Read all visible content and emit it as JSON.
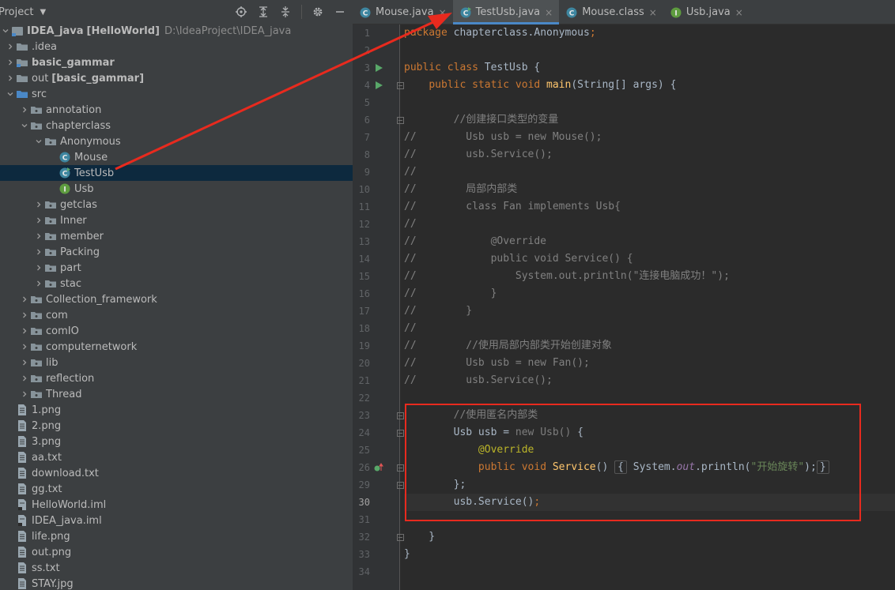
{
  "panel": {
    "title": "Project",
    "tools": [
      "locate-icon",
      "expand-all-icon",
      "collapse-all-icon",
      "gear-icon",
      "minimize-icon"
    ]
  },
  "tree": [
    {
      "label": "IDEA_java",
      "suffix": "[HelloWorld]",
      "path": "D:\\IdeaProject\\IDEA_java",
      "icon": "module-icon",
      "indent": 0,
      "arrow": "open"
    },
    {
      "label": ".idea",
      "icon": "folder-icon",
      "indent": 1,
      "arrow": "closed"
    },
    {
      "label": "basic_gammar",
      "icon": "module-folder-icon",
      "indent": 1,
      "arrow": "closed",
      "bold": true
    },
    {
      "label": "out",
      "suffix": "[basic_gammar]",
      "icon": "folder-icon",
      "indent": 1,
      "arrow": "closed"
    },
    {
      "label": "src",
      "icon": "source-folder-icon",
      "indent": 1,
      "arrow": "open"
    },
    {
      "label": "annotation",
      "icon": "package-icon",
      "indent": 2,
      "arrow": "closed"
    },
    {
      "label": "chapterclass",
      "icon": "package-icon",
      "indent": 2,
      "arrow": "open"
    },
    {
      "label": "Anonymous",
      "icon": "package-icon",
      "indent": 3,
      "arrow": "open"
    },
    {
      "label": "Mouse",
      "icon": "class-icon",
      "indent": 4,
      "arrow": "none"
    },
    {
      "label": "TestUsb",
      "icon": "runnable-class-icon",
      "indent": 4,
      "arrow": "none",
      "selected": true
    },
    {
      "label": "Usb",
      "icon": "interface-icon",
      "indent": 4,
      "arrow": "none"
    },
    {
      "label": "getclas",
      "icon": "package-icon",
      "indent": 3,
      "arrow": "closed"
    },
    {
      "label": "Inner",
      "icon": "package-icon",
      "indent": 3,
      "arrow": "closed"
    },
    {
      "label": "member",
      "icon": "package-icon",
      "indent": 3,
      "arrow": "closed"
    },
    {
      "label": "Packing",
      "icon": "package-icon",
      "indent": 3,
      "arrow": "closed"
    },
    {
      "label": "part",
      "icon": "package-icon",
      "indent": 3,
      "arrow": "closed"
    },
    {
      "label": "stac",
      "icon": "package-icon",
      "indent": 3,
      "arrow": "closed"
    },
    {
      "label": "Collection_framework",
      "icon": "package-icon",
      "indent": 2,
      "arrow": "closed"
    },
    {
      "label": "com",
      "icon": "package-icon",
      "indent": 2,
      "arrow": "closed"
    },
    {
      "label": "comIO",
      "icon": "package-icon",
      "indent": 2,
      "arrow": "closed"
    },
    {
      "label": "computernetwork",
      "icon": "package-icon",
      "indent": 2,
      "arrow": "closed"
    },
    {
      "label": "lib",
      "icon": "package-icon",
      "indent": 2,
      "arrow": "closed"
    },
    {
      "label": "reflection",
      "icon": "package-icon",
      "indent": 2,
      "arrow": "closed"
    },
    {
      "label": "Thread",
      "icon": "package-icon",
      "indent": 2,
      "arrow": "closed"
    },
    {
      "label": "1.png",
      "icon": "file-icon",
      "indent": 1,
      "arrow": "none"
    },
    {
      "label": "2.png",
      "icon": "file-icon",
      "indent": 1,
      "arrow": "none"
    },
    {
      "label": "3.png",
      "icon": "file-icon",
      "indent": 1,
      "arrow": "none"
    },
    {
      "label": "aa.txt",
      "icon": "file-icon",
      "indent": 1,
      "arrow": "none"
    },
    {
      "label": "download.txt",
      "icon": "file-icon",
      "indent": 1,
      "arrow": "none"
    },
    {
      "label": "gg.txt",
      "icon": "file-icon",
      "indent": 1,
      "arrow": "none"
    },
    {
      "label": "HelloWorld.iml",
      "icon": "iml-file-icon",
      "indent": 1,
      "arrow": "none"
    },
    {
      "label": "IDEA_java.iml",
      "icon": "iml-file-icon",
      "indent": 1,
      "arrow": "none"
    },
    {
      "label": "life.png",
      "icon": "file-icon",
      "indent": 1,
      "arrow": "none"
    },
    {
      "label": "out.png",
      "icon": "file-icon",
      "indent": 1,
      "arrow": "none"
    },
    {
      "label": "ss.txt",
      "icon": "file-icon",
      "indent": 1,
      "arrow": "none"
    },
    {
      "label": "STAY.jpg",
      "icon": "file-icon",
      "indent": 1,
      "arrow": "none"
    }
  ],
  "tabs": [
    {
      "label": "Mouse.java",
      "icon": "class-icon",
      "active": false
    },
    {
      "label": "TestUsb.java",
      "icon": "runnable-class-icon",
      "active": true
    },
    {
      "label": "Mouse.class",
      "icon": "class-icon",
      "active": false
    },
    {
      "label": "Usb.java",
      "icon": "interface-icon",
      "active": false
    }
  ],
  "editor": {
    "current_line": "30",
    "lines": [
      {
        "n": "1",
        "code": [
          [
            "kw",
            "package"
          ],
          [
            "t",
            " chapterclass.Anonymous"
          ],
          [
            "kw",
            ";"
          ]
        ]
      },
      {
        "n": "2",
        "code": []
      },
      {
        "n": "3",
        "run": true,
        "code": [
          [
            "kw",
            "public class "
          ],
          [
            "t",
            "TestUsb {"
          ]
        ]
      },
      {
        "n": "4",
        "run": true,
        "fold": true,
        "code": [
          [
            "t",
            "    "
          ],
          [
            "kw",
            "public static void "
          ],
          [
            "fn",
            "main"
          ],
          [
            "t",
            "(String[] args) {"
          ]
        ]
      },
      {
        "n": "5",
        "code": []
      },
      {
        "n": "6",
        "fold": true,
        "code": [
          [
            "cm",
            "        //创建接口类型的变量"
          ]
        ]
      },
      {
        "n": "7",
        "code": [
          [
            "cm",
            "//        Usb usb = new Mouse();"
          ]
        ]
      },
      {
        "n": "8",
        "code": [
          [
            "cm",
            "//        usb.Service();"
          ]
        ]
      },
      {
        "n": "9",
        "code": [
          [
            "cm",
            "//"
          ]
        ]
      },
      {
        "n": "10",
        "code": [
          [
            "cm",
            "//        局部内部类"
          ]
        ]
      },
      {
        "n": "11",
        "code": [
          [
            "cm",
            "//        class Fan implements Usb{"
          ]
        ]
      },
      {
        "n": "12",
        "code": [
          [
            "cm",
            "//"
          ]
        ]
      },
      {
        "n": "13",
        "code": [
          [
            "cm",
            "//            @Override"
          ]
        ]
      },
      {
        "n": "14",
        "code": [
          [
            "cm",
            "//            public void Service() {"
          ]
        ]
      },
      {
        "n": "15",
        "code": [
          [
            "cm",
            "//                System.out.println(\"连接电脑成功！\");"
          ]
        ]
      },
      {
        "n": "16",
        "code": [
          [
            "cm",
            "//            }"
          ]
        ]
      },
      {
        "n": "17",
        "code": [
          [
            "cm",
            "//        }"
          ]
        ]
      },
      {
        "n": "18",
        "code": [
          [
            "cm",
            "//"
          ]
        ]
      },
      {
        "n": "19",
        "code": [
          [
            "cm",
            "//        //使用局部内部类开始创建对象"
          ]
        ]
      },
      {
        "n": "20",
        "code": [
          [
            "cm",
            "//        Usb usb = new Fan();"
          ]
        ]
      },
      {
        "n": "21",
        "code": [
          [
            "cm",
            "//        usb.Service();"
          ]
        ]
      },
      {
        "n": "22",
        "code": []
      },
      {
        "n": "23",
        "fold": true,
        "code": [
          [
            "cm",
            "        //使用匿名内部类"
          ]
        ]
      },
      {
        "n": "24",
        "fold": true,
        "code": [
          [
            "t",
            "        Usb usb = "
          ],
          [
            "dim",
            "new Usb() "
          ],
          [
            "t",
            "{"
          ]
        ]
      },
      {
        "n": "25",
        "code": [
          [
            "t",
            "            "
          ],
          [
            "an",
            "@Override"
          ]
        ]
      },
      {
        "n": "26",
        "impl": true,
        "fold": true,
        "code": [
          [
            "t",
            "            "
          ],
          [
            "kw",
            "public void "
          ],
          [
            "fn",
            "Service"
          ],
          [
            "t",
            "() "
          ],
          [
            "fb",
            "{"
          ],
          [
            "t",
            " System."
          ],
          [
            "it",
            "out"
          ],
          [
            "t",
            ".println("
          ],
          [
            "st",
            "\"开始旋转\""
          ],
          [
            "t",
            ");"
          ],
          [
            "fb",
            "}"
          ]
        ]
      },
      {
        "n": "29",
        "fold": true,
        "code": [
          [
            "t",
            "        };"
          ]
        ]
      },
      {
        "n": "30",
        "code": [
          [
            "t",
            "        usb.Service()"
          ],
          [
            "kw",
            ";"
          ]
        ]
      },
      {
        "n": "31",
        "code": []
      },
      {
        "n": "32",
        "fold": true,
        "code": [
          [
            "t",
            "    }"
          ]
        ]
      },
      {
        "n": "33",
        "code": [
          [
            "t",
            "}"
          ]
        ]
      },
      {
        "n": "34",
        "code": []
      }
    ]
  },
  "colors": {
    "annotation_red": "#e82a1e",
    "selection": "#0d293e",
    "tab_active_underline": "#4a88c7"
  }
}
